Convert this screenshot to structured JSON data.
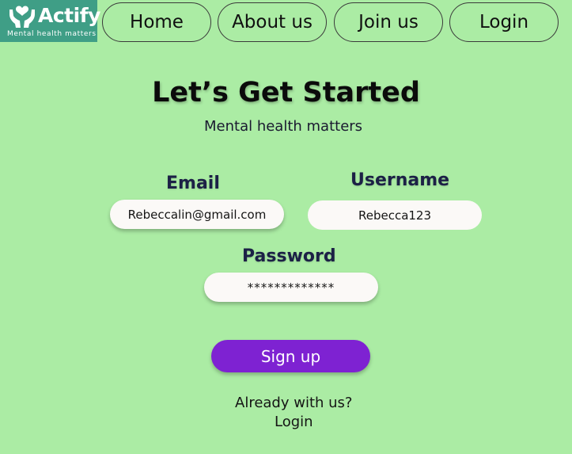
{
  "brand": {
    "name": "Actify",
    "tagline": "Mental health matters",
    "logo_icon": "hands-heart-icon",
    "bg_color": "#3f9e86"
  },
  "nav": {
    "items": [
      {
        "label": "Home"
      },
      {
        "label": "About us"
      },
      {
        "label": "Join us"
      },
      {
        "label": "Login"
      }
    ]
  },
  "header": {
    "title": "Let’s Get Started",
    "subtitle": "Mental health matters"
  },
  "form": {
    "email": {
      "label": "Email",
      "value": "Rebeccalin@gmail.com"
    },
    "username": {
      "label": "Username",
      "value": "Rebecca123"
    },
    "password": {
      "label": "Password",
      "value": "*************"
    },
    "submit_label": "Sign up"
  },
  "footer": {
    "already_text": "Already with us?",
    "login_label": "Login"
  },
  "colors": {
    "background": "#abeca4",
    "accent": "#7e22d2",
    "input_bg": "#fbf9f7"
  }
}
